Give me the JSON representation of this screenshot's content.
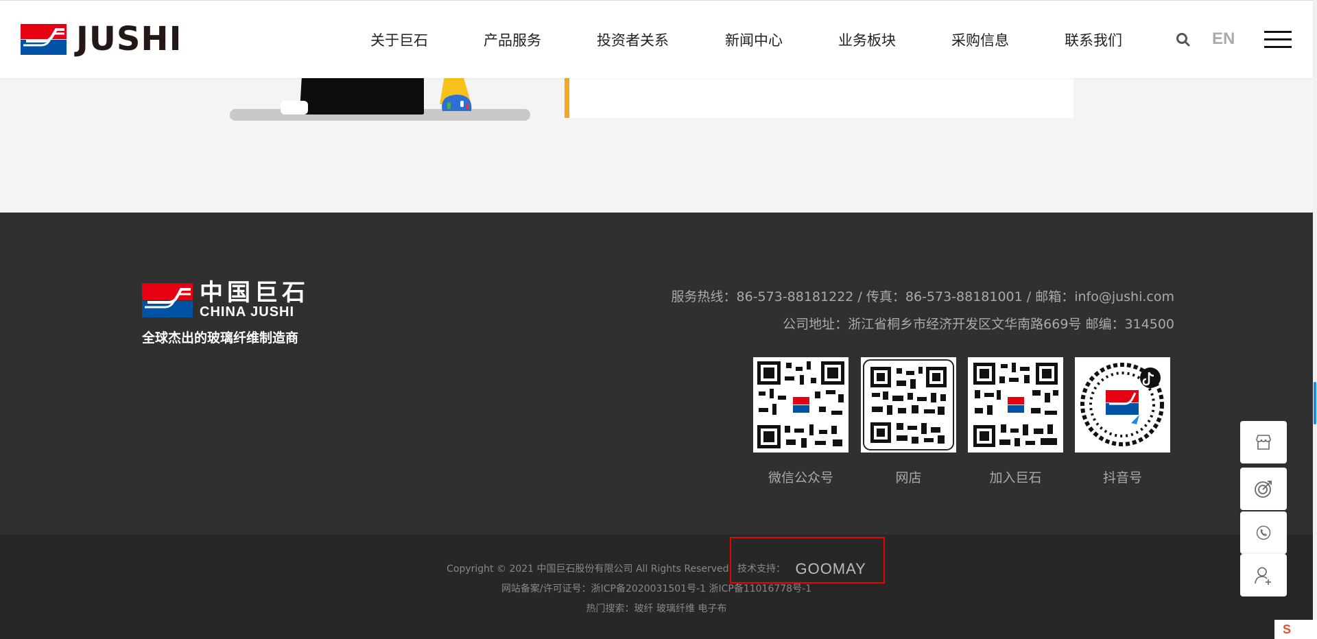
{
  "header": {
    "logo_text": "JUSHI",
    "nav": [
      "关于巨石",
      "产品服务",
      "投资者关系",
      "新闻中心",
      "业务板块",
      "采购信息",
      "联系我们"
    ],
    "lang": "EN",
    "icons": [
      "search-icon",
      "menu-icon"
    ]
  },
  "footer": {
    "logo_cn": "中国巨石",
    "logo_en": "CHINA JUSHI",
    "slogan": "全球杰出的玻璃纤维制造商",
    "contact_line1": "服务热线：86-573-88181222 / 传真：86-573-88181001 / 邮箱：info@jushi.com",
    "contact_line2": "公司地址：浙江省桐乡市经济开发区文华南路669号 邮编：314500",
    "qrcodes": [
      {
        "label": "微信公众号"
      },
      {
        "label": "网店"
      },
      {
        "label": "加入巨石"
      },
      {
        "label": "抖音号"
      }
    ]
  },
  "bottom": {
    "copyright": "Copyright © 2021 中国巨石股份有限公司 All Rights Reserved",
    "tech_label": "技术支持：",
    "tech_brand": "GOOMAY",
    "icp": "网站备案/许可证号：浙ICP备2020031501号-1   浙ICP备11016778号-1",
    "hot_search": "热门搜索：玻纤  玻璃纤维  电子布"
  },
  "side_buttons": [
    "store-icon",
    "target-icon",
    "phone-icon",
    "add-user-icon"
  ],
  "ime": "S",
  "colors": {
    "brand_red": "#e60012",
    "brand_blue": "#0052a5",
    "accent_orange": "#f5a623",
    "footer_bg": "#303030"
  }
}
